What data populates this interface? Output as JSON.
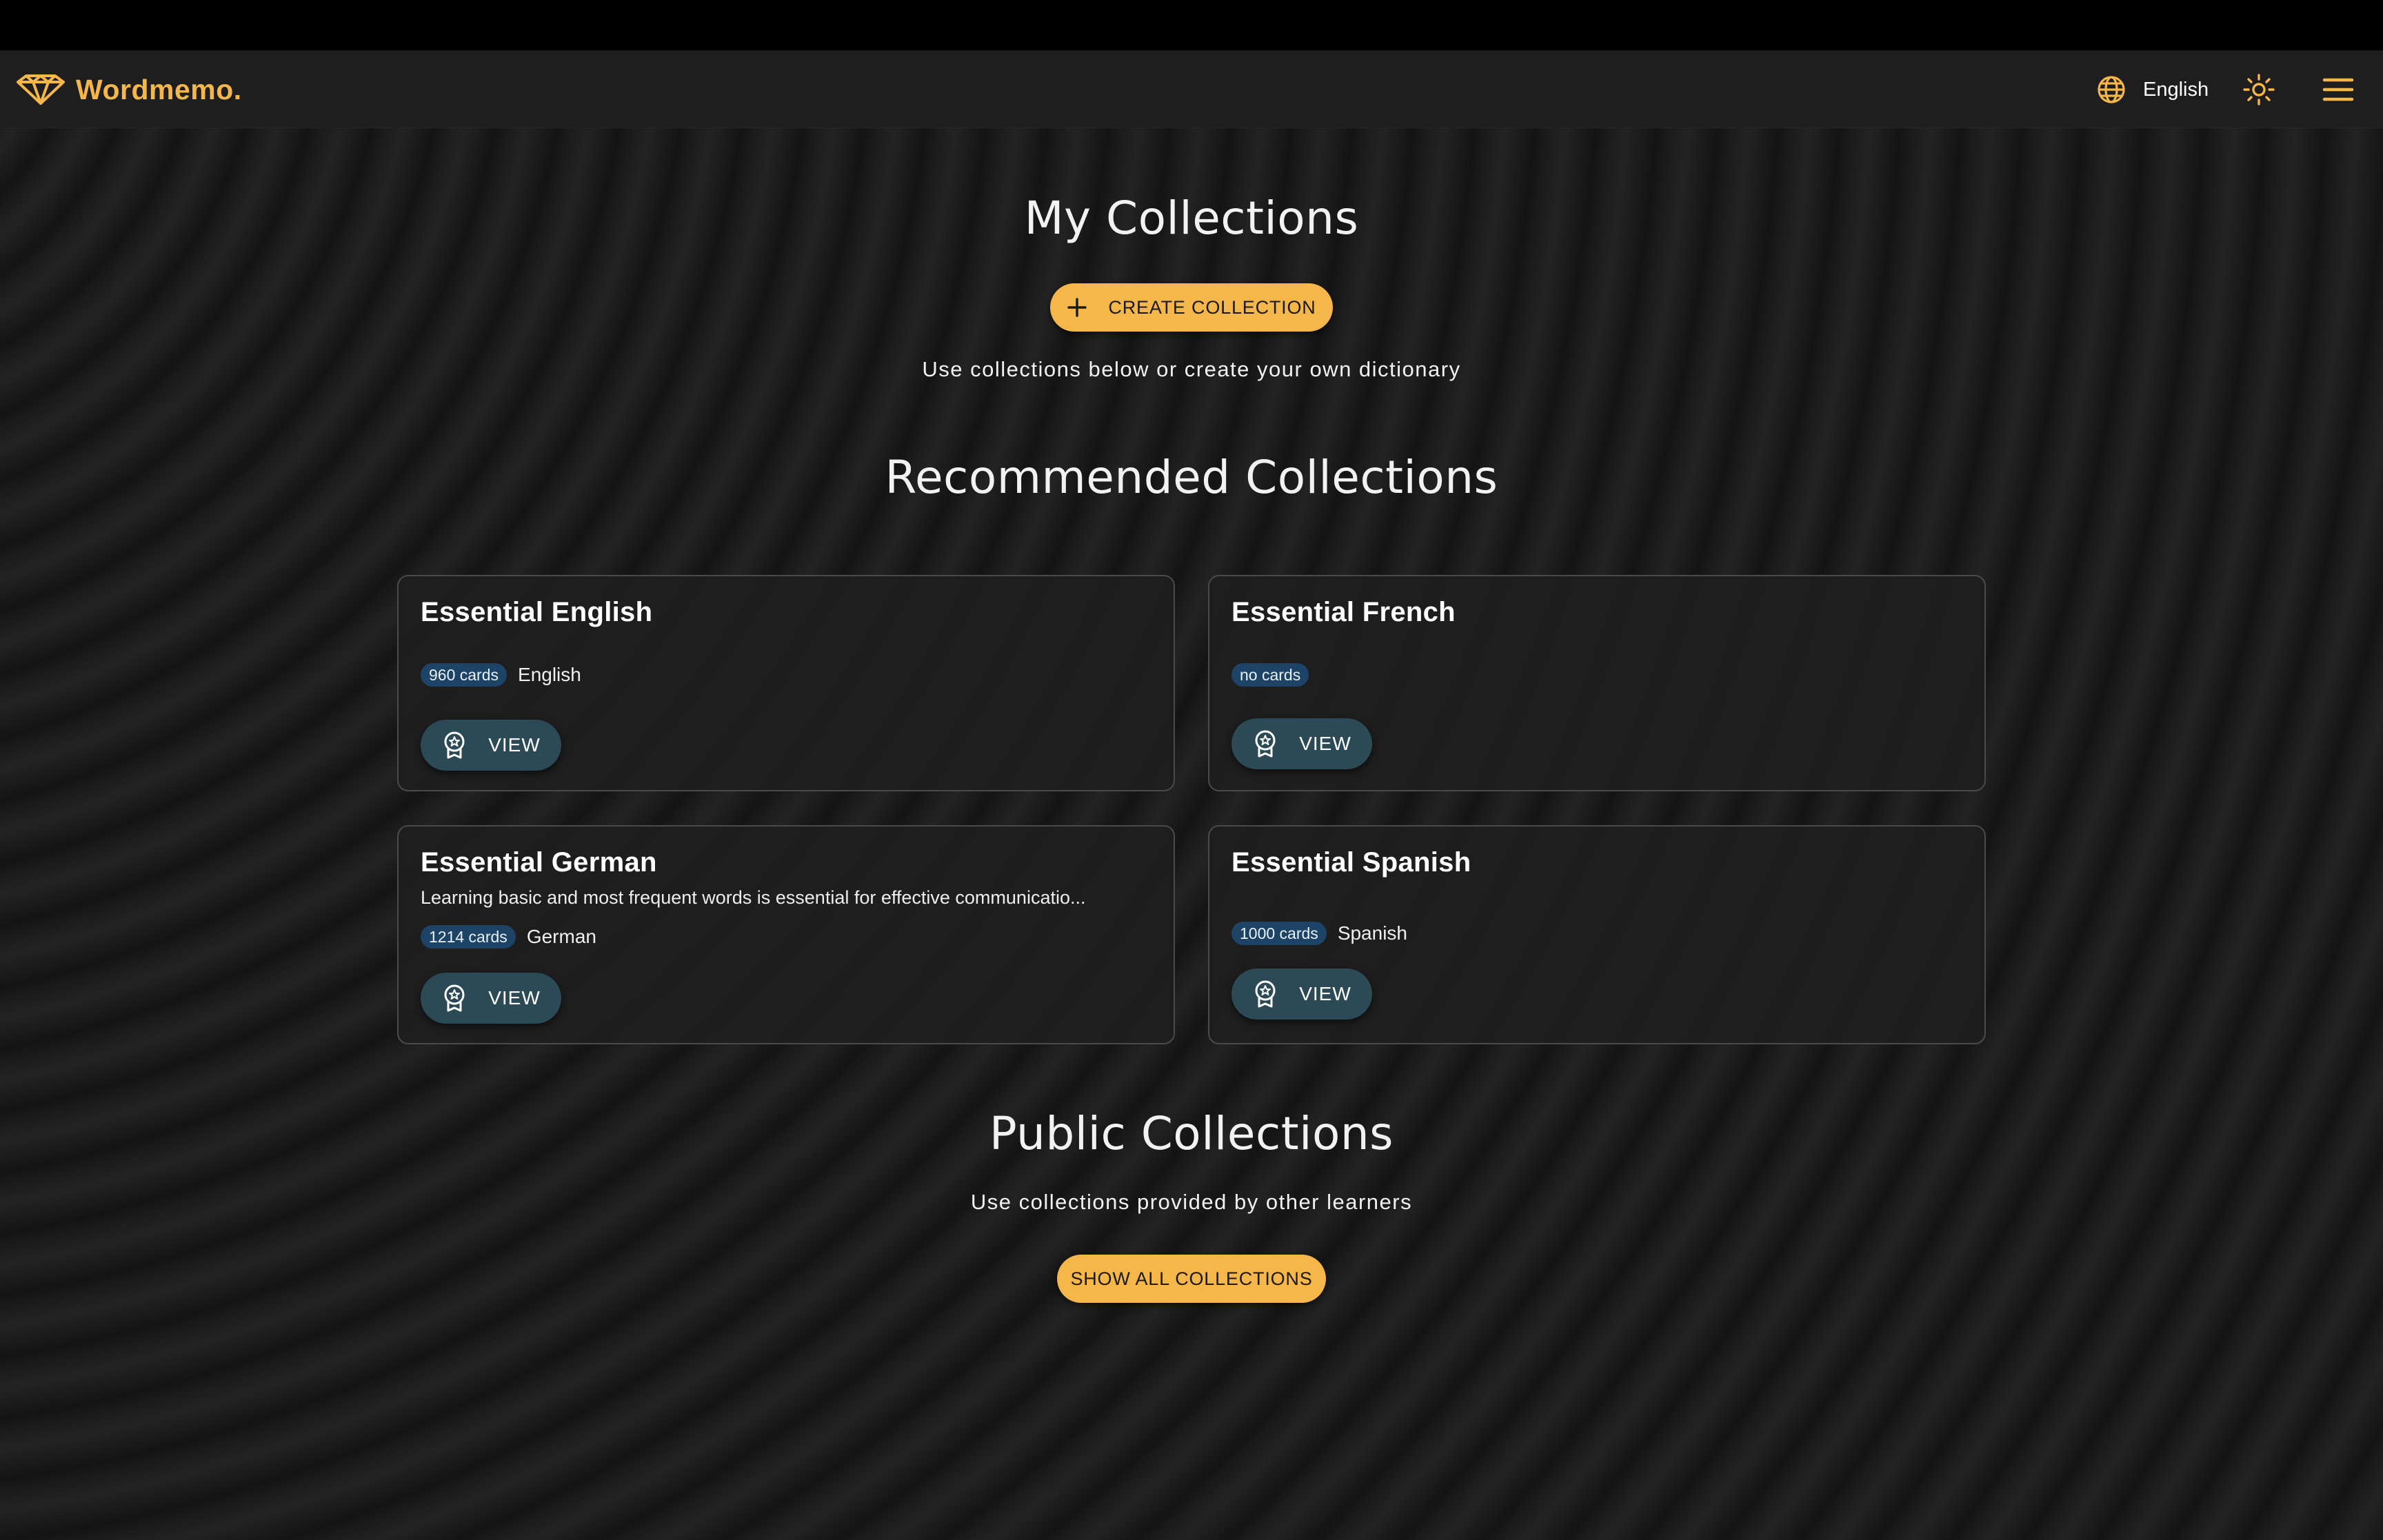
{
  "header": {
    "brand": "Wordmemo.",
    "language": "English"
  },
  "my_collections": {
    "title": "My Collections",
    "create_button": "CREATE COLLECTION",
    "subtitle": "Use collections below or create your own dictionary"
  },
  "recommended": {
    "title": "Recommended Collections",
    "cards": [
      {
        "title": "Essential English",
        "description": "",
        "cards_badge": "960 cards",
        "language": "English",
        "view_label": "VIEW"
      },
      {
        "title": "Essential French",
        "description": "",
        "cards_badge": "no cards",
        "language": "",
        "view_label": "VIEW"
      },
      {
        "title": "Essential German",
        "description": "Learning basic and most frequent words is essential for effective communicatio...",
        "cards_badge": "1214 cards",
        "language": "German",
        "view_label": "VIEW"
      },
      {
        "title": "Essential Spanish",
        "description": "",
        "cards_badge": "1000 cards",
        "language": "Spanish",
        "view_label": "VIEW"
      }
    ]
  },
  "public_collections": {
    "title": "Public Collections",
    "subtitle": "Use collections provided by other learners",
    "show_all_button": "SHOW ALL COLLECTIONS"
  },
  "icons": {
    "brand": "diamond-logo-icon",
    "language": "globe-icon",
    "theme": "sun-icon",
    "menu": "hamburger-menu-icon",
    "create": "plus-icon",
    "view": "award-badge-icon"
  },
  "colors": {
    "accent": "#f5b64a",
    "header_bg": "#1e1e1e",
    "chip_bg": "#1d4466",
    "view_button_bg": "#2c4a55"
  }
}
